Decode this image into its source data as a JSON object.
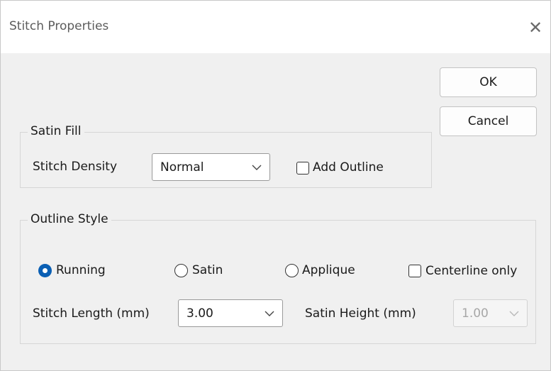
{
  "window": {
    "title": "Stitch Properties",
    "close_glyph": "✕"
  },
  "buttons": {
    "ok": "OK",
    "cancel": "Cancel"
  },
  "satin_fill": {
    "legend": "Satin Fill",
    "density_label": "Stitch Density",
    "density_value": "Normal",
    "add_outline_label": "Add Outline",
    "add_outline_checked": false
  },
  "outline_style": {
    "legend": "Outline Style",
    "radios": [
      {
        "label": "Running",
        "selected": true
      },
      {
        "label": "Satin",
        "selected": false
      },
      {
        "label": "Applique",
        "selected": false
      }
    ],
    "centerline_label": "Centerline only",
    "centerline_checked": false,
    "stitch_length_label": "Stitch Length (mm)",
    "stitch_length_value": "3.00",
    "satin_height_label": "Satin Height (mm)",
    "satin_height_value": "1.00",
    "satin_height_enabled": false
  },
  "colors": {
    "accent": "#0a5fb4",
    "dialog_bg": "#f0f0f0",
    "titlebar_bg": "#ffffff"
  },
  "icons": {
    "close": "close-icon",
    "dropdown": "chevron-down-icon"
  }
}
